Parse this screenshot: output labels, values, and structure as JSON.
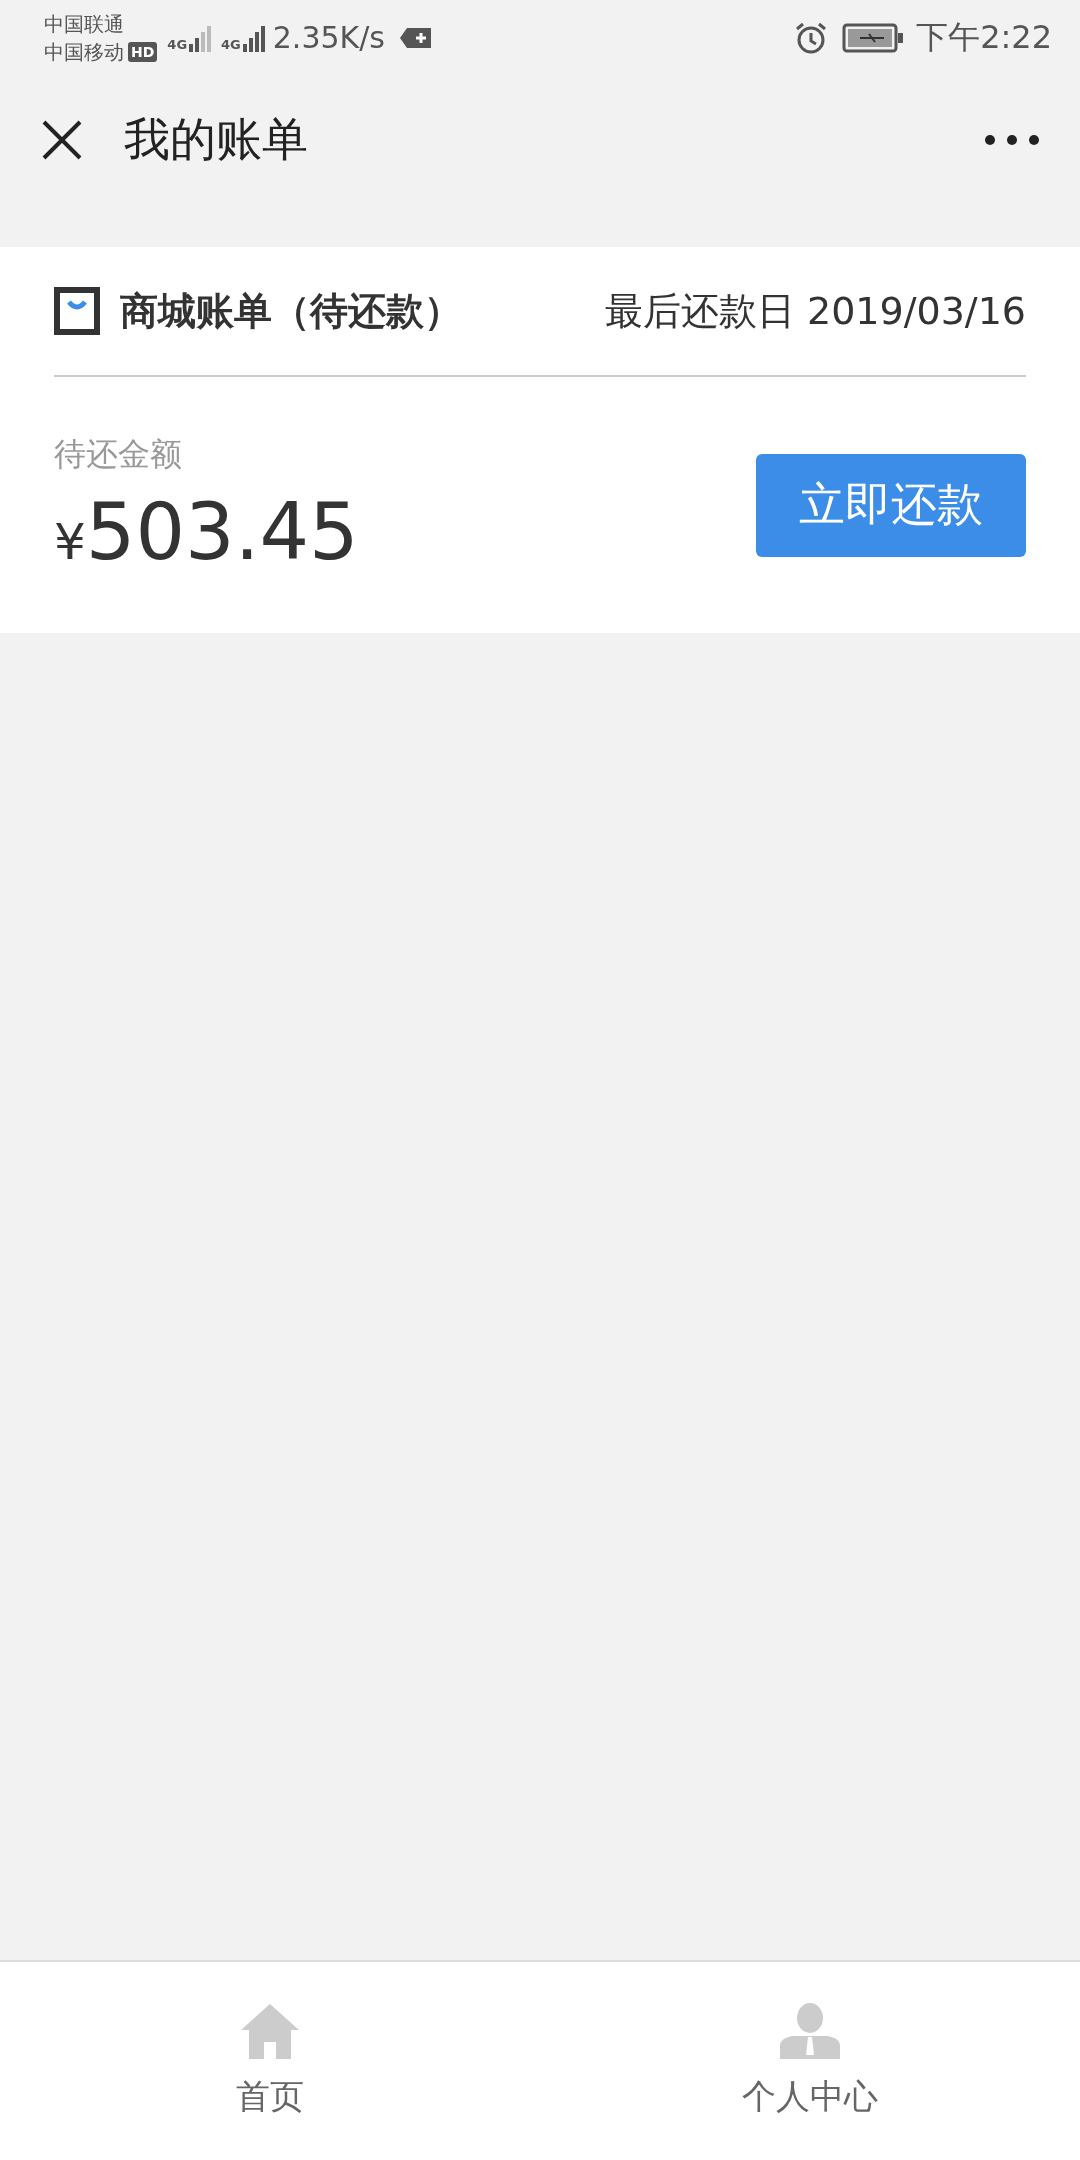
{
  "status_bar": {
    "carrier_1": "中国联通",
    "carrier_2": "中国移动",
    "hd_badge": "HD",
    "network_1": "4G",
    "network_2": "4G",
    "speed": "2.35K/s",
    "time": "下午2:22"
  },
  "title_bar": {
    "title": "我的账单"
  },
  "bill": {
    "title": "商城账单（待还款）",
    "due_date": "最后还款日 2019/03/16",
    "amount_label": "待还金额",
    "currency": "¥",
    "amount": "503.45",
    "pay_button": "立即还款"
  },
  "tabs": [
    {
      "label": "首页",
      "kind": "home",
      "selected": false
    },
    {
      "label": "个人中心",
      "kind": "profile",
      "selected": false
    }
  ]
}
